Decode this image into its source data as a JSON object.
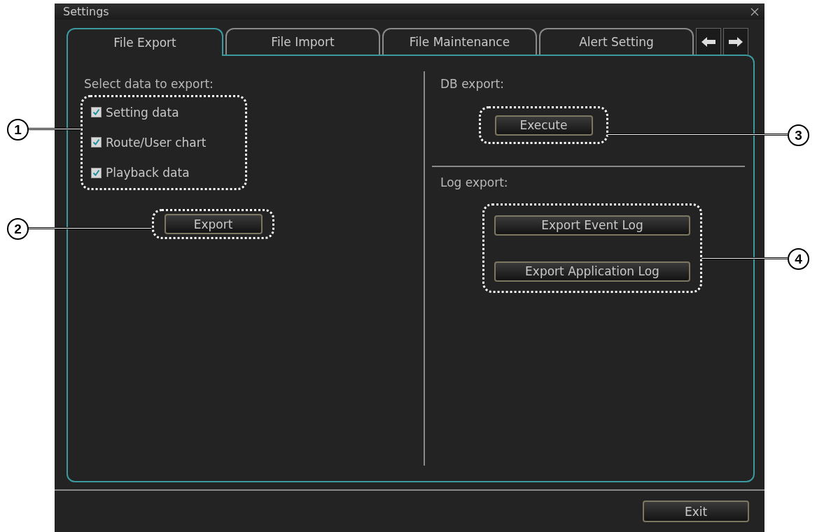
{
  "window": {
    "title": "Settings"
  },
  "tabs": [
    {
      "label": "File Export",
      "selected": true
    },
    {
      "label": "File Import",
      "selected": false
    },
    {
      "label": "File Maintenance",
      "selected": false
    },
    {
      "label": "Alert Setting",
      "selected": false
    }
  ],
  "export_section": {
    "label": "Select data to export:",
    "options": [
      {
        "label": "Setting data",
        "checked": true
      },
      {
        "label": "Route/User chart",
        "checked": true
      },
      {
        "label": "Playback data",
        "checked": true
      }
    ],
    "button": "Export"
  },
  "db_export": {
    "label": "DB export:",
    "button": "Execute"
  },
  "log_export": {
    "label": "Log export:",
    "buttons": [
      "Export Event Log",
      "Export Application Log"
    ]
  },
  "footer": {
    "button": "Exit"
  },
  "callouts": [
    "1",
    "2",
    "3",
    "4"
  ]
}
